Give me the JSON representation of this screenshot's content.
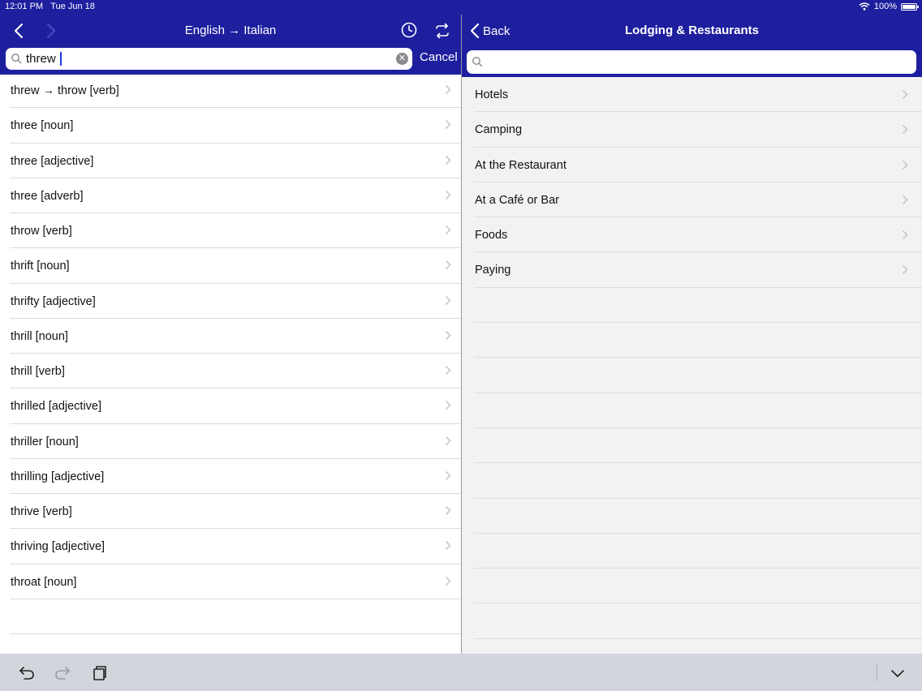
{
  "status": {
    "time": "12:01 PM",
    "date": "Tue Jun 18",
    "battery": "100%"
  },
  "left_panel": {
    "title": "English → Italian",
    "search": {
      "value": "threw",
      "placeholder": ""
    },
    "cancel_label": "Cancel",
    "results": [
      "threw → throw [verb]",
      "three [noun]",
      "three [adjective]",
      "three [adverb]",
      "throw [verb]",
      "thrift [noun]",
      "thrifty [adjective]",
      "thrill [noun]",
      "thrill [verb]",
      "thrilled [adjective]",
      "thriller [noun]",
      "thrilling [adjective]",
      "thrive [verb]",
      "thriving [adjective]",
      "throat [noun]"
    ]
  },
  "right_panel": {
    "back_label": "Back",
    "title": "Lodging & Restaurants",
    "search": {
      "placeholder": ""
    },
    "categories": [
      "Hotels",
      "Camping",
      "At the Restaurant",
      "At a Café or Bar",
      "Foods",
      "Paying"
    ]
  },
  "colors": {
    "nav_bar": "#1e1f9e",
    "toolbar": "#d2d5db",
    "caret": "#1e3ce0"
  },
  "icons": {
    "nav": [
      "chevron-left-icon",
      "chevron-right-icon",
      "history-icon",
      "swap-icon",
      "search-icon",
      "clear-icon"
    ],
    "toolbar": [
      "undo-icon",
      "redo-icon",
      "clipboard-icon",
      "chevron-down-icon"
    ]
  }
}
